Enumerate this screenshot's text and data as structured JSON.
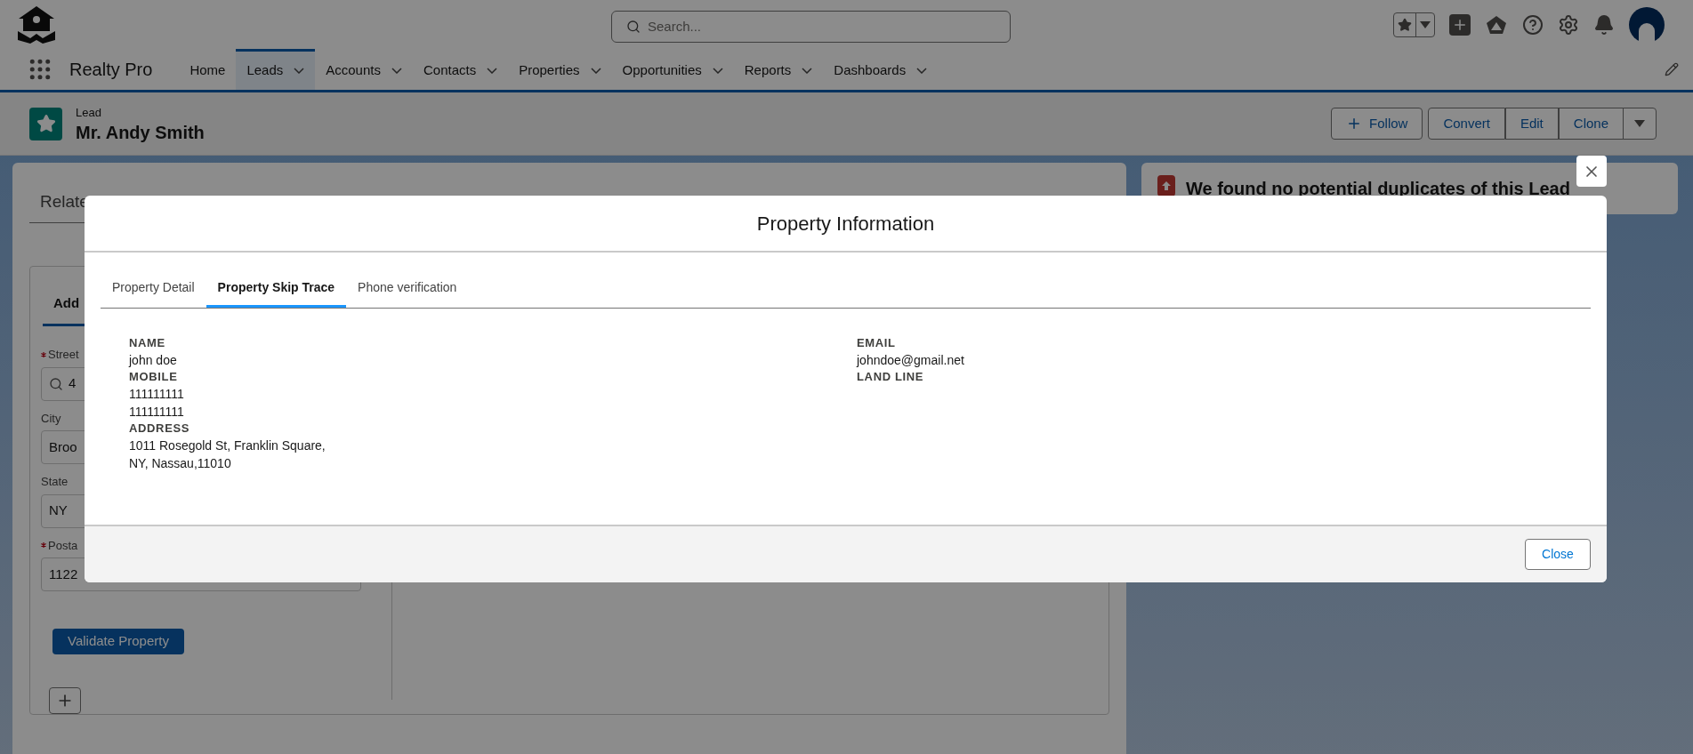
{
  "app": {
    "name": "Realty Pro",
    "search": {
      "placeholder": "Search..."
    }
  },
  "nav": [
    {
      "label": "Home",
      "selected": false,
      "has_menu": false
    },
    {
      "label": "Leads",
      "selected": true,
      "has_menu": true
    },
    {
      "label": "Accounts",
      "selected": false,
      "has_menu": true
    },
    {
      "label": "Contacts",
      "selected": false,
      "has_menu": true
    },
    {
      "label": "Properties",
      "selected": false,
      "has_menu": true
    },
    {
      "label": "Opportunities",
      "selected": false,
      "has_menu": true
    },
    {
      "label": "Reports",
      "selected": false,
      "has_menu": true
    },
    {
      "label": "Dashboards",
      "selected": false,
      "has_menu": true
    }
  ],
  "record": {
    "type": "Lead",
    "title": "Mr. Andy Smith",
    "actions": [
      {
        "label": "Follow",
        "kind": "follow"
      },
      {
        "label": "Convert",
        "kind": "group"
      },
      {
        "label": "Edit",
        "kind": "group"
      },
      {
        "label": "Clone",
        "kind": "group"
      }
    ]
  },
  "background": {
    "related_tab": "Relate",
    "section_tab": "Add",
    "fields": [
      {
        "label": "Street",
        "required": true,
        "value": "4",
        "kind": "search"
      },
      {
        "label": "City",
        "required": false,
        "value": "Broo",
        "kind": "text"
      },
      {
        "label": "State",
        "required": false,
        "value": "NY",
        "kind": "text"
      },
      {
        "label": "Posta",
        "required": true,
        "value": "1122",
        "kind": "text"
      }
    ],
    "validate_button": "Validate Property",
    "duplicates_notice": "We found no potential duplicates of this Lead"
  },
  "modal": {
    "title": "Property Information",
    "tabs": [
      {
        "label": "Property Detail",
        "selected": false
      },
      {
        "label": "Property Skip Trace",
        "selected": true
      },
      {
        "label": "Phone verification",
        "selected": false
      }
    ],
    "left_fields": [
      {
        "label": "NAME",
        "values": [
          "john doe"
        ]
      },
      {
        "label": "MOBILE",
        "values": [
          "111111111",
          "111111111"
        ]
      },
      {
        "label": "ADDRESS",
        "values": [
          "1011 Rosegold St, Franklin Square,",
          "NY, Nassau,11010"
        ]
      }
    ],
    "right_fields": [
      {
        "label": "EMAIL",
        "values": [
          "johndoe@gmail.net"
        ]
      },
      {
        "label": "LAND LINE"
      }
    ],
    "close_button": "Close"
  }
}
